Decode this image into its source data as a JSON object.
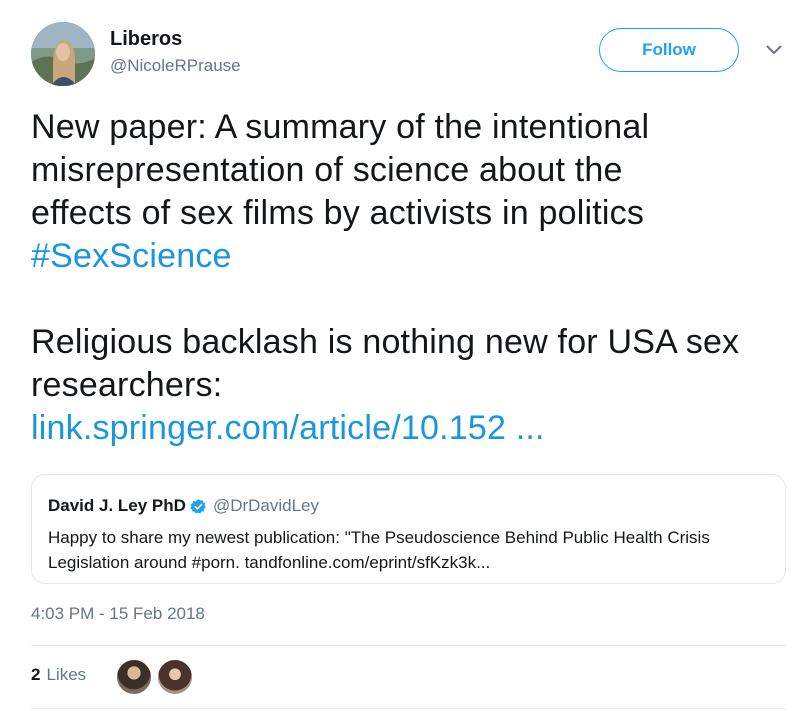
{
  "author": {
    "name": "Liberos",
    "handle": "@NicoleRPrause",
    "avatar_icon": "profile-photo"
  },
  "actions": {
    "follow_label": "Follow",
    "menu_icon": "chevron-down-icon"
  },
  "tweet": {
    "lines": [
      "New paper: A summary of the intentional",
      "misrepresentation of science about the",
      "effects of sex films by activists in politics"
    ],
    "hashtag": "#SexScience",
    "lines2": [
      "Religious backlash is nothing new for USA sex",
      "researchers:"
    ],
    "link": "link.springer.com/article/10.152 ..."
  },
  "quoted_tweet": {
    "name": "David J. Ley PhD",
    "verified_icon": "verified-badge-icon",
    "handle": "@DrDavidLey",
    "line1": "Happy to share my newest publication: \"The Pseudoscience Behind Public Health Crisis",
    "line2": "Legislation around #porn. tandfonline.com/eprint/sfKzk3k..."
  },
  "timestamp": "4:03 PM - 15 Feb 2018",
  "stats": {
    "likes_count": "2",
    "likes_label": "Likes"
  },
  "colors": {
    "accent": "#1da1f2",
    "link": "#1b95e0",
    "secondary_text": "#657786",
    "border": "#e1e8ed"
  }
}
